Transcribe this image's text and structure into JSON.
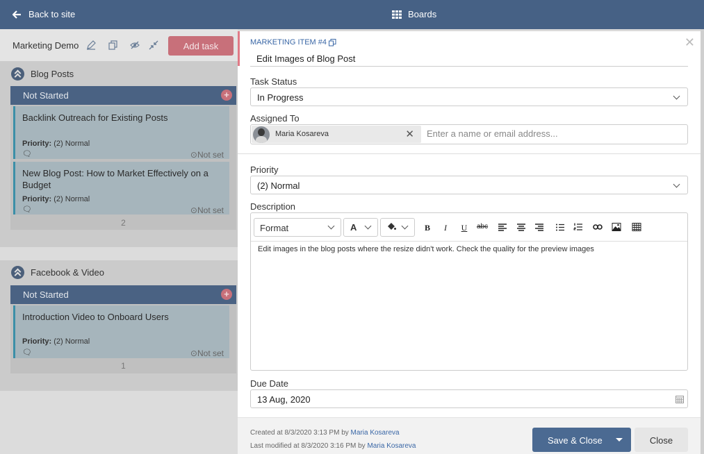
{
  "topbar": {
    "back_label": "Back to site",
    "boards_label": "Boards"
  },
  "board": {
    "title": "Marketing Demo",
    "add_task_label": "Add task",
    "groups": [
      {
        "title": "Blog Posts",
        "column": "Not Started",
        "count": "2",
        "cards": [
          {
            "title": "Backlink Outreach for Existing Posts",
            "priority_label": "Priority:",
            "priority_value": "(2) Normal",
            "due": "Not set"
          },
          {
            "title": "New Blog Post: How to Market Effectively on a Budget",
            "priority_label": "Priority:",
            "priority_value": "(2) Normal",
            "due": "Not set"
          }
        ]
      },
      {
        "title": "Facebook & Video",
        "column": "Not Started",
        "count": "1",
        "cards": [
          {
            "title": "Introduction Video to Onboard Users",
            "priority_label": "Priority:",
            "priority_value": "(2) Normal",
            "due": "Not set"
          }
        ]
      }
    ]
  },
  "panel": {
    "item_id": "MARKETING ITEM #4",
    "title": "Edit Images of Blog Post",
    "task_status_label": "Task Status",
    "task_status_value": "In Progress",
    "assigned_label": "Assigned To",
    "assignee": "Maria Kosareva",
    "assign_placeholder": "Enter a name or email address...",
    "priority_label": "Priority",
    "priority_value": "(2) Normal",
    "description_label": "Description",
    "format_label": "Format",
    "font_label": "A",
    "description_text": "Edit images in the blog posts where the resize didn't work. Check the quality for the preview images",
    "due_label": "Due Date",
    "due_value": "13 Aug, 2020",
    "created_prefix": "Created at 8/3/2020 3:13 PM by",
    "created_by": "Maria Kosareva",
    "modified_prefix": "Last modified at 8/3/2020 3:16 PM by",
    "modified_by": "Maria Kosareva",
    "save_label": "Save & Close",
    "close_label": "Close"
  },
  "colors": {
    "topbar": "#466185",
    "accent": "#c8707a",
    "column": "#4a6283",
    "primary_button": "#4b6a92",
    "link": "#3a67a6"
  }
}
